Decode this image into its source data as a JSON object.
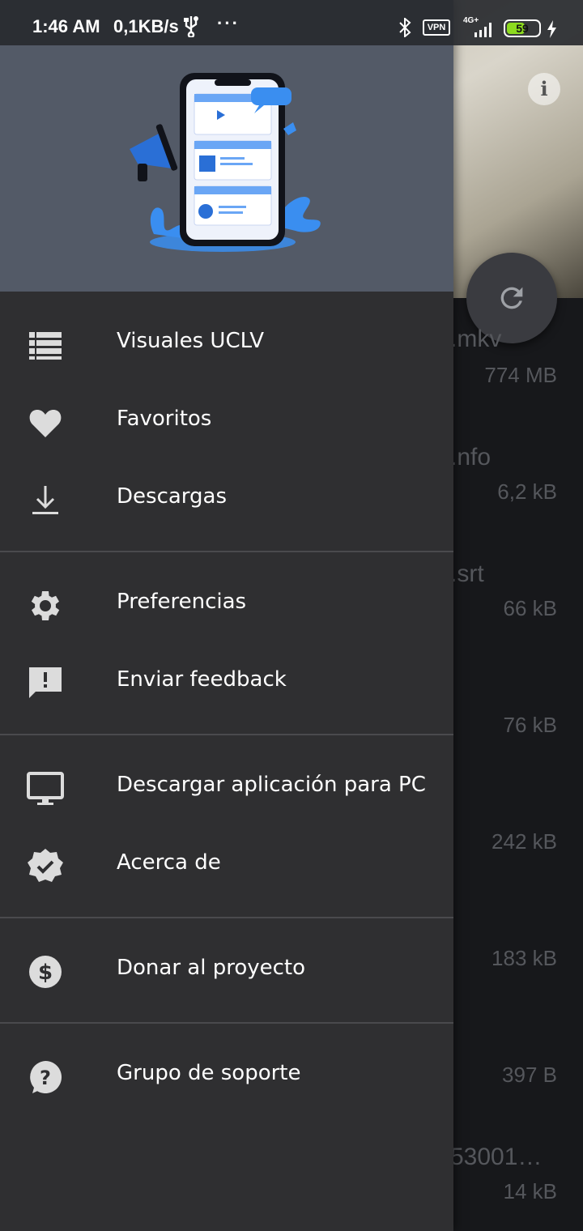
{
  "status_bar": {
    "time": "1:46 AM",
    "speed": "0,1KB/s",
    "more": "···",
    "vpn": "VPN",
    "network": "4G+",
    "battery": "59",
    "battery_level": 0.59,
    "icons": [
      "usb-icon",
      "bluetooth-icon",
      "signal-icon",
      "charging-icon"
    ]
  },
  "drawer": {
    "groups": [
      [
        {
          "label": "Visuales UCLV",
          "icon": "list-icon"
        },
        {
          "label": "Favoritos",
          "icon": "heart-icon"
        },
        {
          "label": "Descargas",
          "icon": "download-icon"
        }
      ],
      [
        {
          "label": "Preferencias",
          "icon": "gear-icon"
        },
        {
          "label": "Enviar feedback",
          "icon": "feedback-icon"
        }
      ],
      [
        {
          "label": "Descargar aplicación para PC",
          "icon": "monitor-icon"
        },
        {
          "label": "Acerca de",
          "icon": "verified-badge-icon"
        }
      ],
      [
        {
          "label": "Donar al proyecto",
          "icon": "dollar-icon"
        }
      ],
      [
        {
          "label": "Grupo de soporte",
          "icon": "help-icon"
        }
      ]
    ]
  },
  "background_list": {
    "items": [
      {
        "name": ".mkv",
        "size": "774 MB"
      },
      {
        "name": ".nfo",
        "size": "6,2 kB"
      },
      {
        "name": ".srt",
        "size": "66 kB"
      },
      {
        "name": "",
        "size": "76 kB"
      },
      {
        "name": "",
        "size": "242 kB"
      },
      {
        "name": "",
        "size": "183 kB"
      },
      {
        "name": "",
        "size": "397 B"
      },
      {
        "name": "53001…",
        "size": "14 kB"
      }
    ]
  },
  "background_header": {
    "info_label": "i"
  }
}
